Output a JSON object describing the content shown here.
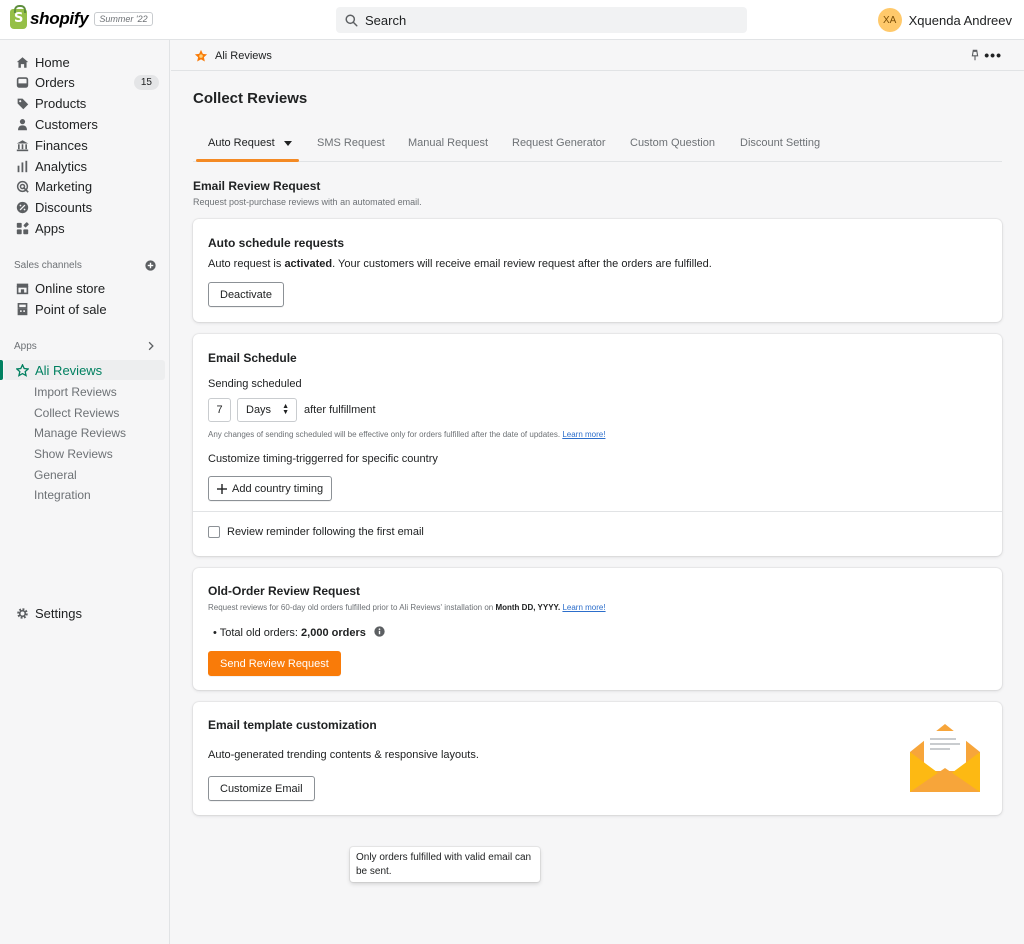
{
  "topbar": {
    "logo_text": "shopify",
    "logo_badge": "Summer '22",
    "search_placeholder": "Search",
    "user_initials": "XA",
    "user_name": "Xquenda Andreev"
  },
  "sidebar": {
    "items": [
      {
        "label": "Home",
        "icon": "home-icon"
      },
      {
        "label": "Orders",
        "icon": "orders-icon",
        "count": "15"
      },
      {
        "label": "Products",
        "icon": "tag-icon"
      },
      {
        "label": "Customers",
        "icon": "person-icon"
      },
      {
        "label": "Finances",
        "icon": "bank-icon"
      },
      {
        "label": "Analytics",
        "icon": "bar-chart-icon"
      },
      {
        "label": "Marketing",
        "icon": "target-icon"
      },
      {
        "label": "Discounts",
        "icon": "discount-icon"
      },
      {
        "label": "Apps",
        "icon": "apps-icon"
      }
    ],
    "sales_channels_label": "Sales channels",
    "channels": [
      {
        "label": "Online store",
        "icon": "store-icon"
      },
      {
        "label": "Point of sale",
        "icon": "pos-icon"
      }
    ],
    "apps_label": "Apps",
    "active_app": "Ali Reviews",
    "app_subitems": [
      "Import Reviews",
      "Collect Reviews",
      "Manage Reviews",
      "Show Reviews",
      "General",
      "Integration"
    ],
    "settings_label": "Settings"
  },
  "appbar": {
    "title": "Ali Reviews"
  },
  "page": {
    "title": "Collect Reviews",
    "tabs": [
      "Auto Request",
      "SMS Request",
      "Manual Request",
      "Request Generator",
      "Custom Question",
      "Discount Setting"
    ],
    "section_title": "Email Review Request",
    "section_subtitle": "Request post-purchase reviews with an automated email."
  },
  "auto_schedule": {
    "title": "Auto schedule requests",
    "text_before": "Auto request is ",
    "text_bold": "activated",
    "text_after": ". Your customers will receive email review request after the orders are fulfilled.",
    "button": "Deactivate"
  },
  "email_schedule": {
    "title": "Email Schedule",
    "sending_label": "Sending scheduled",
    "days_value": "7",
    "unit_value": "Days",
    "after_label": "after fulfillment",
    "note": "Any changes of sending scheduled will be effective only for orders fulfilled after the date of updates.",
    "learn_more": "Learn more!",
    "customize_label": "Customize timing-triggerred for specific country",
    "add_button": "Add country timing",
    "reminder_label": "Review reminder following the first email"
  },
  "old_order": {
    "title": "Old-Order Review Request",
    "desc_before": "Request reviews for 60-day old orders fulfilled prior to Ali Reviews' installation on ",
    "desc_bold": "Month DD, YYYY.",
    "learn_more": "Learn more!",
    "total_label": "Total old orders: ",
    "total_value": "2,000 orders",
    "button": "Send Review Request"
  },
  "template": {
    "title": "Email template customization",
    "text": "Auto-generated trending contents & responsive layouts.",
    "button": "Customize Email"
  },
  "tooltip": {
    "text": "Only orders fulfilled with valid email can be sent."
  },
  "colors": {
    "accent": "#f97b09",
    "active_green": "#008060",
    "link": "#2c6ecb"
  }
}
